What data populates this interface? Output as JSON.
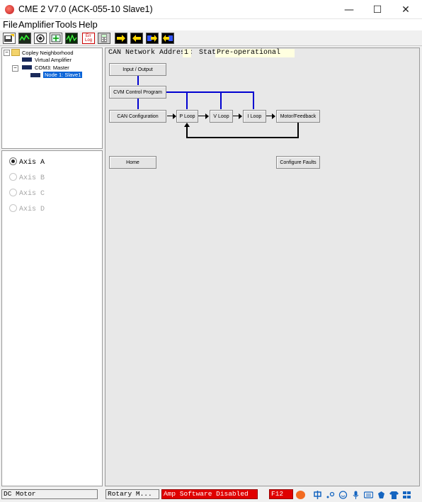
{
  "window": {
    "title": "CME 2 V7.0 (ACK-055-10 Slave1)",
    "minimize_glyph": "—",
    "maximize_glyph": "☐",
    "close_glyph": "✕"
  },
  "menu": [
    {
      "label": "File"
    },
    {
      "label": "Amplifier"
    },
    {
      "label": "Tools"
    },
    {
      "label": "Help"
    }
  ],
  "toolbar": {
    "icons": [
      "save-icon",
      "scope-icon",
      "config-icon",
      "control-panel-icon",
      "waveform-icon",
      "error-log-icon",
      "calculator-icon",
      "download-icon",
      "upload-icon",
      "restore-icon",
      "backup-icon"
    ],
    "error_log_text": "Err Log"
  },
  "tree": {
    "root": "Copley Neighborhood",
    "virtual": "Virtual Amplifier",
    "port": "COM3: Master",
    "node": "Node 1: Slave1",
    "expand_glyph": "−"
  },
  "axes": {
    "selected": "Axis A",
    "items": [
      "Axis A",
      "Axis B",
      "Axis C",
      "Axis D"
    ]
  },
  "status_row": {
    "can_label": "CAN Network Address:",
    "can_value": "1",
    "state_label": "State:",
    "state_value": "Pre-operational"
  },
  "blocks": {
    "input_output": "Input / Output",
    "cvm": "CVM Control Program",
    "can_config": "CAN Configuration",
    "p_loop": "P Loop",
    "v_loop": "V Loop",
    "i_loop": "I Loop",
    "motor_feedback": "Motor/Feedback",
    "home": "Home",
    "configure_faults": "Configure Faults"
  },
  "colors": {
    "wire_blue": "#0000d0",
    "fault_red": "#e00000",
    "selected_node": "#0a64d8",
    "state_bg": "#ffffe0"
  },
  "statusbar": {
    "motor_type": "DC Motor",
    "motor_family": "Rotary M...",
    "amp_status": "Amp Software Disabled",
    "extra": "F12"
  }
}
